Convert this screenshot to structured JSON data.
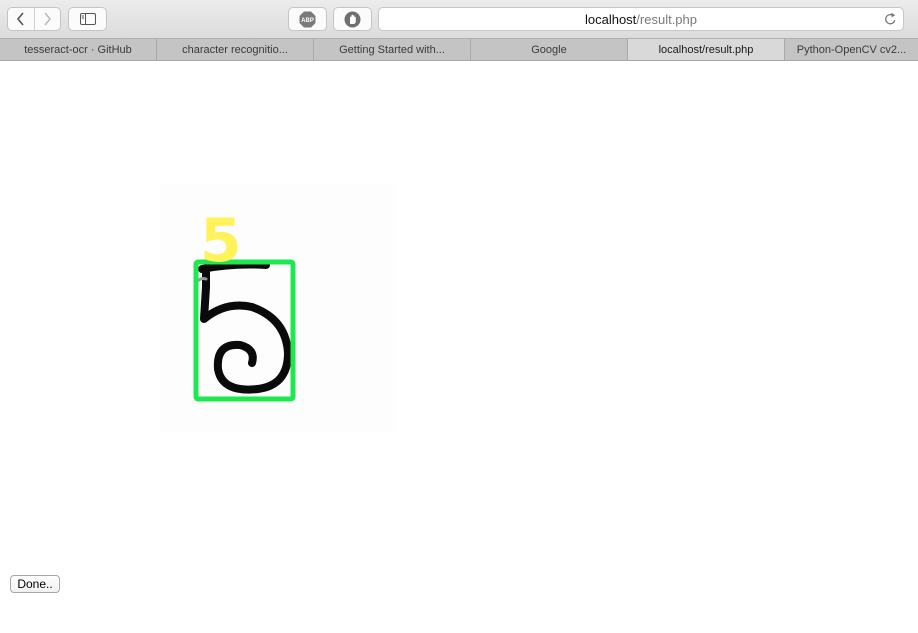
{
  "browser": {
    "address": {
      "host": "localhost",
      "path": "/result.php"
    },
    "tabs": [
      {
        "label": "tesseract-ocr · GitHub"
      },
      {
        "label": "character recognitio..."
      },
      {
        "label": "Getting Started with..."
      },
      {
        "label": "Google"
      },
      {
        "label": "localhost/result.php",
        "active": true
      },
      {
        "label": "Python-OpenCV cv2..."
      }
    ],
    "extensions": {
      "abp_label": "ABP"
    }
  },
  "result": {
    "predicted_label": "5",
    "box_color": "#1ee84f",
    "label_color": "#fff25a"
  },
  "page": {
    "done_button_label": "Done.."
  }
}
